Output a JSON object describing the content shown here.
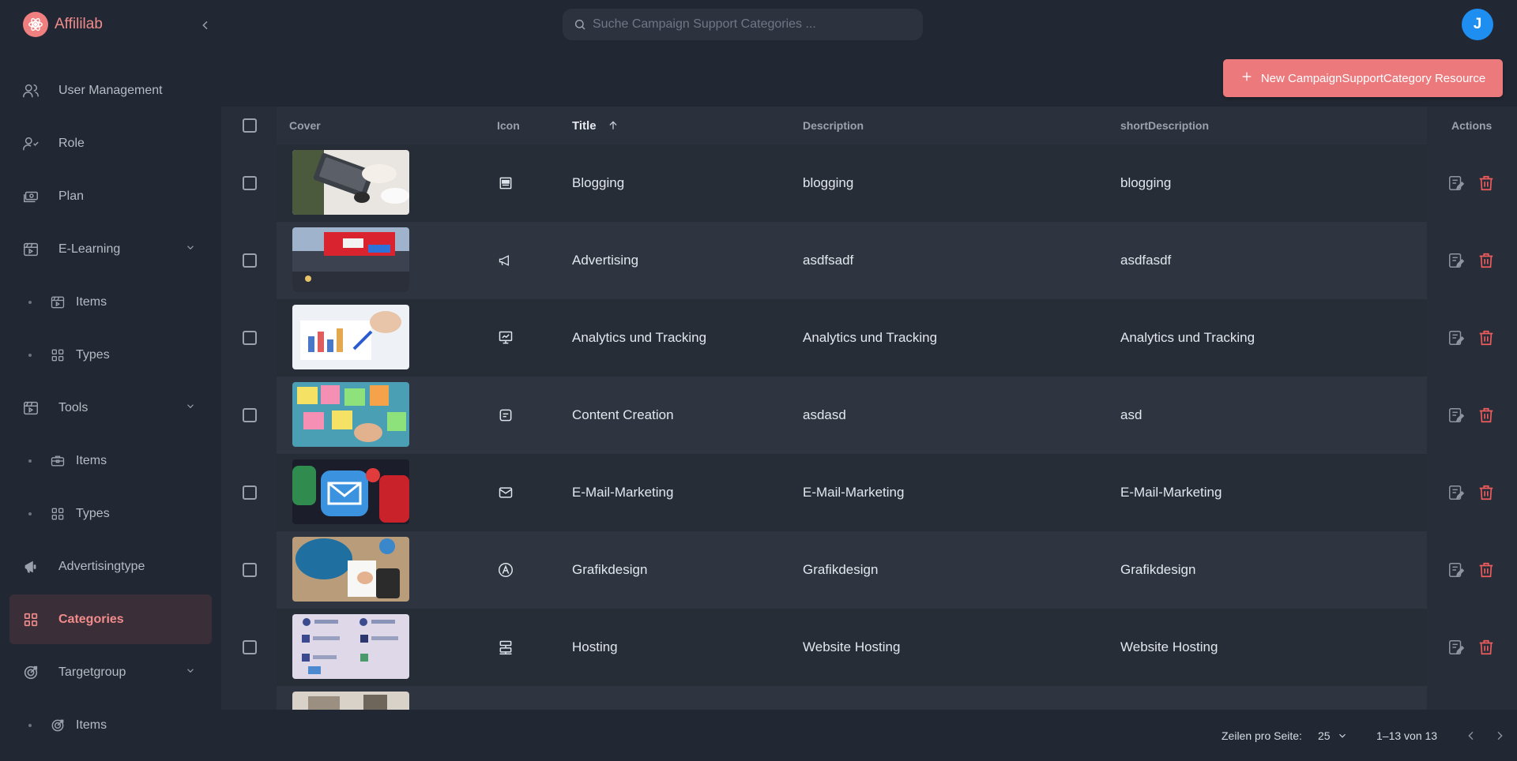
{
  "app": {
    "name": "Affililab",
    "accent": "#f08080"
  },
  "header": {
    "search_placeholder": "Suche Campaign Support Categories ...",
    "user_initial": "J",
    "new_button_label": "New CampaignSupportCategory Resource"
  },
  "sidebar": {
    "items": [
      {
        "label": "User Management",
        "icon": "users-icon"
      },
      {
        "label": "Role",
        "icon": "user-role-icon"
      },
      {
        "label": "Plan",
        "icon": "cash-icon"
      },
      {
        "label": "E-Learning",
        "icon": "video-icon",
        "expandable": true
      },
      {
        "label": "Items",
        "icon": "video-icon",
        "sub": true
      },
      {
        "label": "Types",
        "icon": "grid-icon",
        "sub": true
      },
      {
        "label": "Tools",
        "icon": "video-icon",
        "expandable": true
      },
      {
        "label": "Items",
        "icon": "toolbox-icon",
        "sub": true
      },
      {
        "label": "Types",
        "icon": "grid-icon",
        "sub": true
      },
      {
        "label": "Advertisingtype",
        "icon": "megaphone-icon"
      },
      {
        "label": "Categories",
        "icon": "grid-icon",
        "active": true
      },
      {
        "label": "Targetgroup",
        "icon": "target-icon",
        "expandable": true
      },
      {
        "label": "Items",
        "icon": "target-icon",
        "sub": true
      }
    ]
  },
  "table": {
    "columns": {
      "cover": "Cover",
      "icon": "Icon",
      "title": "Title",
      "description": "Description",
      "short_description": "shortDescription",
      "actions": "Actions"
    },
    "rows": [
      {
        "title": "Blogging",
        "description": "blogging",
        "short": "blogging",
        "icon": "article-icon"
      },
      {
        "title": "Advertising",
        "description": "asdfsadf",
        "short": "asdfasdf",
        "icon": "megaphone-icon"
      },
      {
        "title": "Analytics und Tracking",
        "description": "Analytics und Tracking",
        "short": "Analytics und Tracking",
        "icon": "presentation-chart-icon"
      },
      {
        "title": "Content Creation",
        "description": "asdasd",
        "short": "asd",
        "icon": "content-icon"
      },
      {
        "title": "E-Mail-Marketing",
        "description": "E-Mail-Marketing",
        "short": "E-Mail-Marketing",
        "icon": "mail-icon"
      },
      {
        "title": "Grafikdesign",
        "description": "Grafikdesign",
        "short": "Grafikdesign",
        "icon": "pen-circle-icon"
      },
      {
        "title": "Hosting",
        "description": "Website Hosting",
        "short": "Website Hosting",
        "icon": "server-icon"
      }
    ]
  },
  "footer": {
    "rows_per_page_label": "Zeilen pro Seite:",
    "rows_per_page_value": "25",
    "range": "1–13 von 13"
  }
}
